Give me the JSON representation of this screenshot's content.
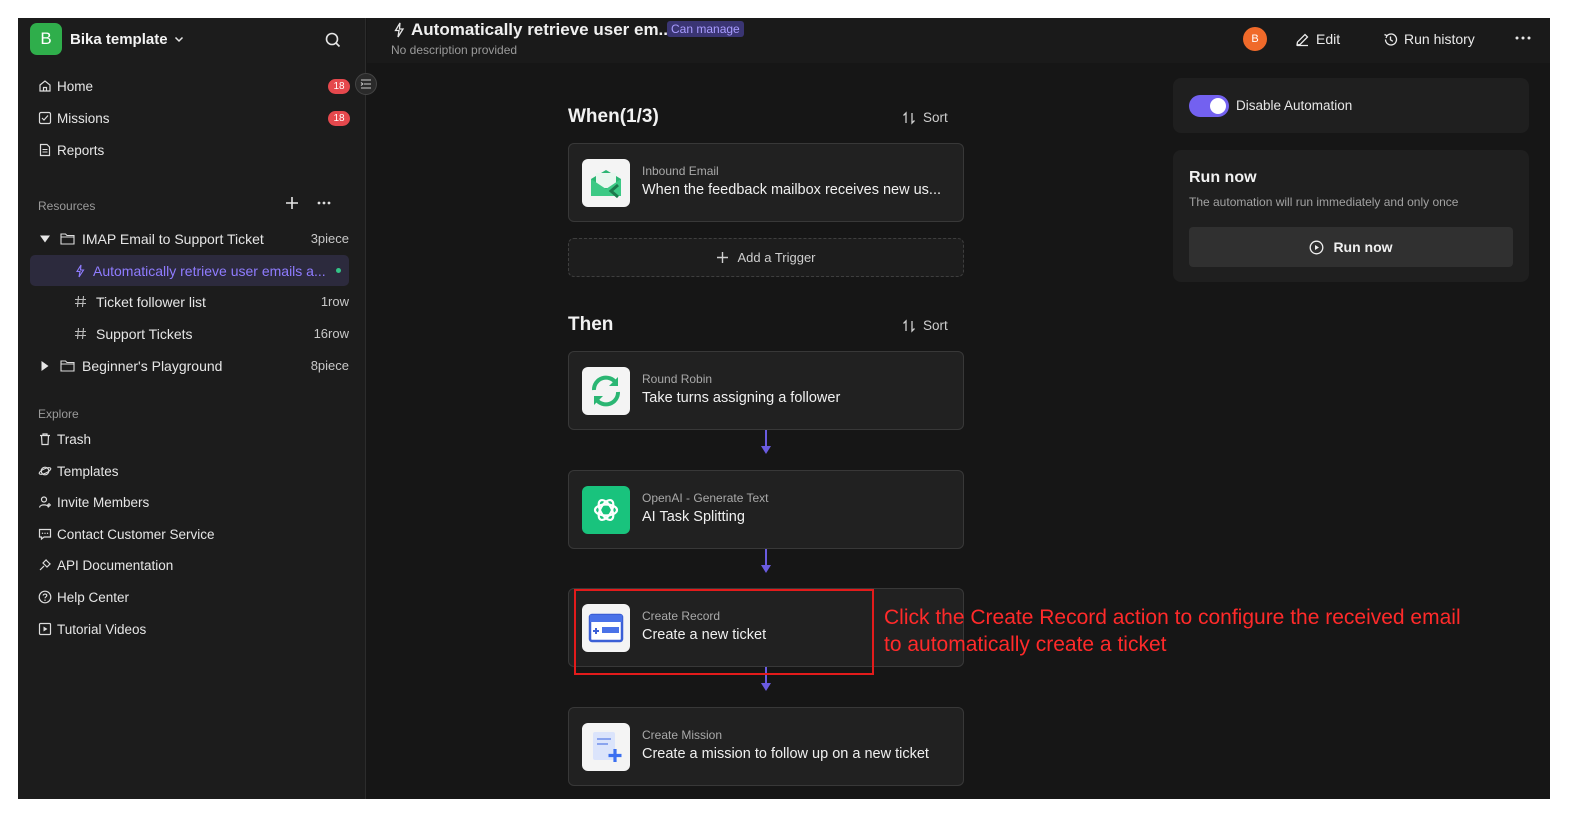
{
  "sidebar": {
    "workspace": {
      "initial": "B",
      "name": "Bika template"
    },
    "nav": [
      {
        "label": "Home",
        "icon": "home-icon",
        "badge": "18"
      },
      {
        "label": "Missions",
        "icon": "checkbox-icon",
        "badge": "18"
      },
      {
        "label": "Reports",
        "icon": "report-icon",
        "badge": ""
      }
    ],
    "resources_label": "Resources",
    "tree": [
      {
        "label": "IMAP Email to Support Ticket",
        "count": "3piece",
        "type": "folder",
        "expanded": true
      },
      {
        "label": "Automatically retrieve user emails a...",
        "count": "",
        "type": "automation",
        "active": true
      },
      {
        "label": "Ticket follower list",
        "count": "1row",
        "type": "table"
      },
      {
        "label": "Support Tickets",
        "count": "16row",
        "type": "table"
      },
      {
        "label": "Beginner's Playground",
        "count": "8piece",
        "type": "folder",
        "expanded": false
      }
    ],
    "explore_label": "Explore",
    "explore": [
      {
        "label": "Trash",
        "icon": "trash-icon"
      },
      {
        "label": "Templates",
        "icon": "planet-icon"
      },
      {
        "label": "Invite Members",
        "icon": "invite-user-icon"
      },
      {
        "label": "Contact Customer Service",
        "icon": "chat-icon"
      },
      {
        "label": "API Documentation",
        "icon": "api-plug-icon"
      },
      {
        "label": "Help Center",
        "icon": "question-circle-icon"
      },
      {
        "label": "Tutorial Videos",
        "icon": "play-square-icon"
      }
    ]
  },
  "header": {
    "title": "Automatically retrieve user em...",
    "permission": "Can manage",
    "description": "No description provided",
    "avatar_initial": "B",
    "edit_label": "Edit",
    "run_history_label": "Run history"
  },
  "flow": {
    "when_heading": "When(1/3)",
    "then_heading": "Then",
    "sort_label": "Sort",
    "add_trigger_label": "Add a Trigger",
    "triggers": [
      {
        "type": "Inbound Email",
        "name": "When the feedback mailbox receives new us..."
      }
    ],
    "actions": [
      {
        "type": "Round Robin",
        "name": "Take turns assigning a follower"
      },
      {
        "type": "OpenAI - Generate Text",
        "name": "AI Task Splitting"
      },
      {
        "type": "Create Record",
        "name": "Create a new ticket"
      },
      {
        "type": "Create Mission",
        "name": "Create a mission to follow up on a new ticket"
      }
    ]
  },
  "callout": {
    "line1": "Click the Create Record action to configure the received email",
    "line2": "to automatically create a ticket"
  },
  "panel": {
    "toggle_label": "Disable Automation",
    "toggle_on": true,
    "run_now_title": "Run now",
    "run_now_desc": "The automation will run immediately and only once",
    "run_now_button": "Run now"
  },
  "colors": {
    "accent": "#7361f0",
    "badge": "#e5484d",
    "brand_green": "#2fae4b",
    "annotation_red": "#e31b1b"
  }
}
